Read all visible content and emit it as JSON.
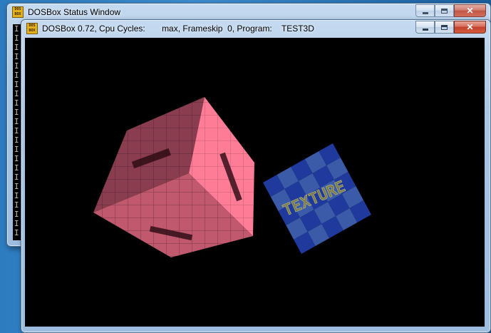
{
  "status_window": {
    "title": "DOSBox Status Window",
    "icon": "dosbox-icon",
    "icon_text": "DOS BOX",
    "log_lines": [
      "I",
      "I",
      "I",
      "I",
      "I",
      "I",
      "I",
      "I",
      "I",
      "I",
      "I",
      "I",
      "I",
      "I",
      "I",
      "I",
      "I",
      "I",
      "I",
      "I",
      "I",
      "I",
      "I"
    ],
    "buttons": {
      "minimize": "minimize-icon",
      "maximize": "maximize-icon",
      "close": "close-icon"
    }
  },
  "main_window": {
    "title": "DOSBox 0.72, Cpu Cycles:       max, Frameskip  0, Program:    TEST3D",
    "icon": "dosbox-icon",
    "icon_text": "DOS BOX",
    "buttons": {
      "minimize": "minimize-icon",
      "maximize": "maximize-icon",
      "close": "close-icon"
    }
  },
  "scene": {
    "cube_color": "#ff7c96",
    "plane_colors": [
      "#1f3a9c",
      "#3b5aa8"
    ],
    "plane_label": "TEXTURE"
  }
}
